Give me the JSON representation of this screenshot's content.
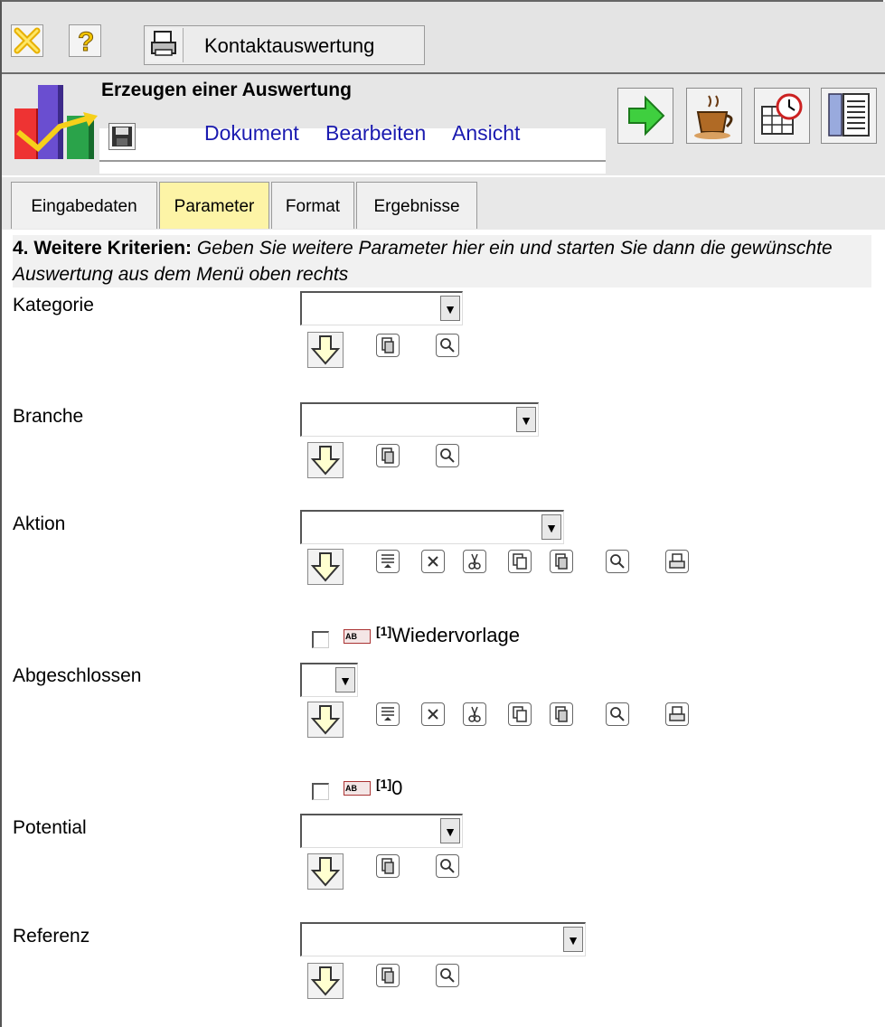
{
  "app": {
    "report_button_label": "Kontaktauswertung",
    "heading": "Erzeugen einer Auswertung",
    "menu": [
      "Dokument",
      "Bearbeiten",
      "Ansicht"
    ]
  },
  "tabs": [
    {
      "label": "Eingabedaten",
      "active": false
    },
    {
      "label": "Parameter",
      "active": true
    },
    {
      "label": "Format",
      "active": false
    },
    {
      "label": "Ergebnisse",
      "active": false
    }
  ],
  "criteria": {
    "title": "4. Weitere Kriterien:",
    "text": "Geben Sie weitere Parameter hier ein und starten Sie dann die gewünschte Auswertung aus dem Menü oben rechts"
  },
  "fields": {
    "kategorie": {
      "label": "Kategorie",
      "value": ""
    },
    "branche": {
      "label": "Branche",
      "value": ""
    },
    "aktion": {
      "label": "Aktion",
      "value": ""
    },
    "abgeschlossen": {
      "label": "Abgeschlossen",
      "value": ""
    },
    "potential": {
      "label": "Potential",
      "value": ""
    },
    "referenz": {
      "label": "Referenz",
      "value": ""
    }
  },
  "aktion_item": {
    "checked": false,
    "index": "[1]",
    "text": "Wiedervorlage"
  },
  "abgeschlossen_item": {
    "checked": false,
    "index": "[1]",
    "text": "0"
  },
  "abicon_text": "AB",
  "colors": {
    "active_tab": "#fdf4a6",
    "link": "#1b1bb0",
    "toolbar_bg": "#e4e4e4"
  }
}
